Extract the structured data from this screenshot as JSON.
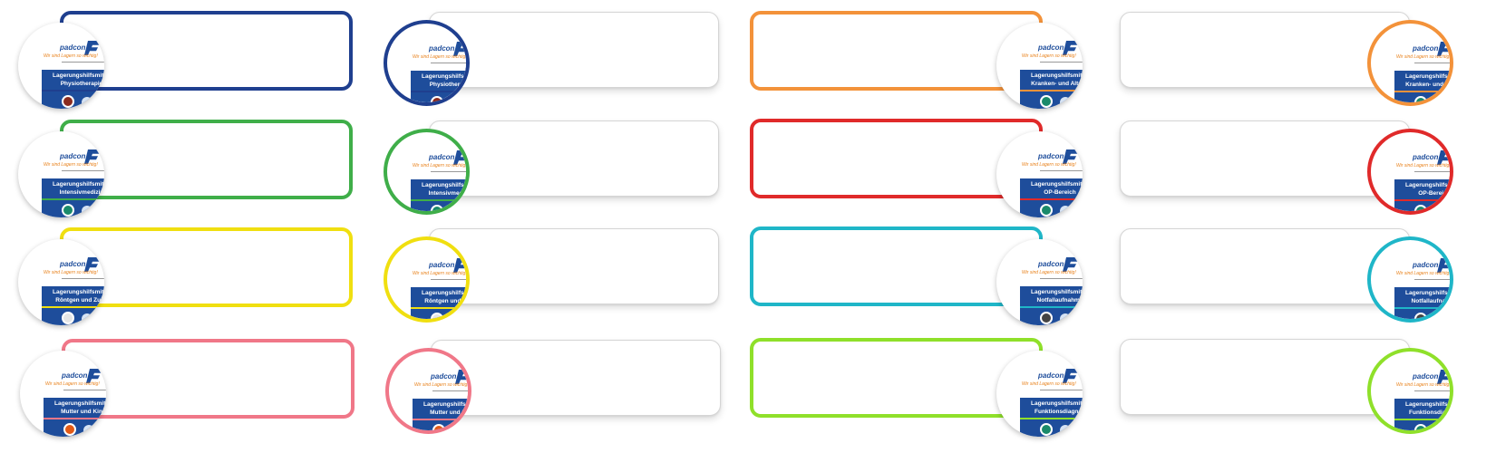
{
  "brochure": {
    "logo_text": "padcon",
    "slogan": "Wir sind Lagern so wichtig!",
    "heading": "Lagerungshilfsmittel"
  },
  "rows": [
    {
      "color": "#1f3f8f",
      "chip_color": "#8b2b1e",
      "left": {
        "subtitle": "Physiotherapie",
        "heading": "Lagerungshilfsmit",
        "subtitle_short": "Physiotherapie"
      },
      "right_subtitle": "Physiotherapie"
    },
    {
      "color": "#3fae49",
      "chip_color": "#1a8a6a",
      "left": {
        "subtitle": "Intensivmedizin"
      },
      "right_subtitle": "Intensivmedizin"
    },
    {
      "color": "#f0df10",
      "chip_color": "#e6e6e6",
      "left": {
        "subtitle": "Röntgen und Zube"
      },
      "right_subtitle": "Röntgen und Zube"
    },
    {
      "color": "#f07788",
      "chip_color": "#e25a16",
      "left": {
        "subtitle": "Mutter und Kind"
      },
      "right_subtitle": "Mutter und Kind"
    }
  ],
  "rows_right": [
    {
      "color": "#f3923a",
      "chip_color": "#1a8a6a",
      "subtitle": "Kranken- und Altenp"
    },
    {
      "color": "#e02a2a",
      "chip_color": "#1a8a6a",
      "subtitle": "OP-Bereich"
    },
    {
      "color": "#1fb6c8",
      "chip_color": "#444444",
      "subtitle": "Notfallaufnahme"
    },
    {
      "color": "#8fe02a",
      "chip_color": "#1a8a6a",
      "subtitle": "Funktionsdiagnos"
    }
  ]
}
